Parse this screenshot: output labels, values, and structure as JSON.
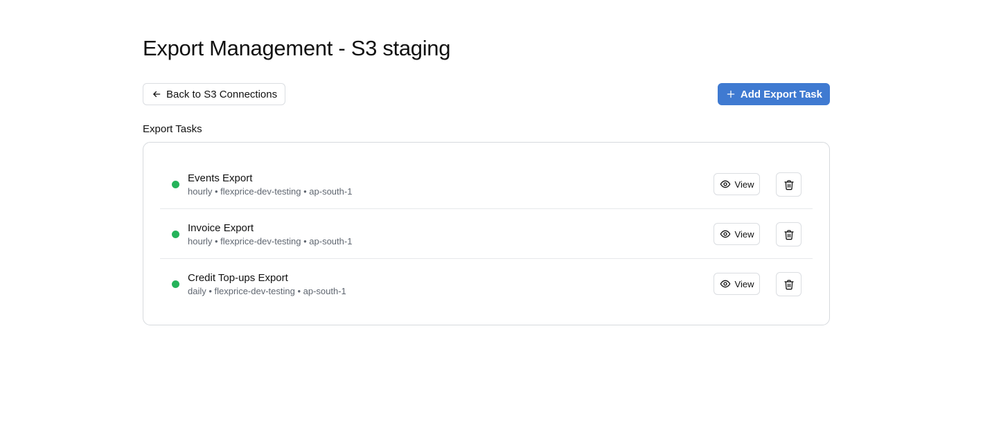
{
  "page": {
    "title": "Export Management - S3 staging"
  },
  "toolbar": {
    "back_label": "Back to S3 Connections",
    "back_icon": "arrow-left-icon",
    "add_label": "Add Export Task",
    "add_icon": "plus-icon"
  },
  "section": {
    "label": "Export Tasks"
  },
  "tasks": [
    {
      "name": "Events Export",
      "meta": "hourly • flexprice-dev-testing • ap-south-1",
      "status": "active",
      "view_label": "View"
    },
    {
      "name": "Invoice Export",
      "meta": "hourly • flexprice-dev-testing • ap-south-1",
      "status": "active",
      "view_label": "View"
    },
    {
      "name": "Credit Top-ups Export",
      "meta": "daily • flexprice-dev-testing • ap-south-1",
      "status": "active",
      "view_label": "View"
    }
  ],
  "colors": {
    "accent": "#3f7ad1",
    "status_active": "#25b35a",
    "border": "#dadde1",
    "muted_text": "#5f6670"
  }
}
